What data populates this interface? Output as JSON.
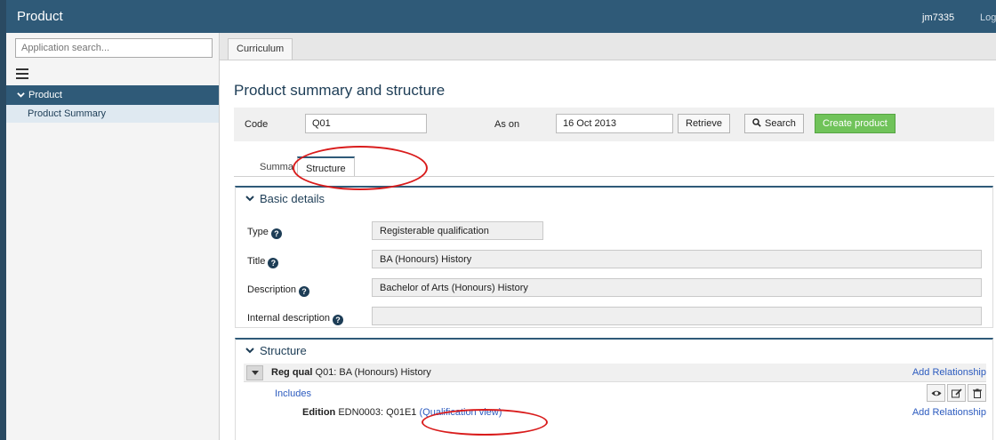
{
  "header": {
    "app_title": "Product",
    "user": "jm7335",
    "logout_label": "Log"
  },
  "sidebar": {
    "search_placeholder": "Application search...",
    "section_label": "Product",
    "items": [
      {
        "label": "Product Summary"
      }
    ]
  },
  "content_tabs": {
    "active": "Curriculum"
  },
  "page": {
    "title": "Product summary and structure"
  },
  "toolbar": {
    "code_label": "Code",
    "code_value": "Q01",
    "as_on_label": "As on",
    "as_on_value": "16 Oct 2013",
    "retrieve_label": "Retrieve",
    "search_label": "Search",
    "create_label": "Create product"
  },
  "tabs": [
    {
      "label": "Summary",
      "visible_label": "Summa"
    },
    {
      "label": "Structure",
      "active": true
    }
  ],
  "basic_details": {
    "heading": "Basic details",
    "fields": [
      {
        "label": "Type",
        "value": "Registerable qualification"
      },
      {
        "label": "Title",
        "value": "BA (Honours) History"
      },
      {
        "label": "Description",
        "value": "Bachelor of Arts (Honours) History"
      },
      {
        "label": "Internal description",
        "value": ""
      }
    ]
  },
  "structure": {
    "heading": "Structure",
    "root": {
      "type_label": "Reg qual",
      "text": "Q01: BA (Honours) History",
      "add_relationship": "Add Relationship"
    },
    "includes_label": "Includes",
    "child": {
      "type_label": "Edition",
      "text_before": "EDN0003: Q01",
      "text_after": "E1",
      "link": "(Qualification view)",
      "add_relationship": "Add Relationship"
    }
  },
  "colors": {
    "header_bg": "#2f5a78",
    "accent_green": "#70c35a",
    "link": "#2c5bbf",
    "annotation_red": "#d91c1c"
  }
}
